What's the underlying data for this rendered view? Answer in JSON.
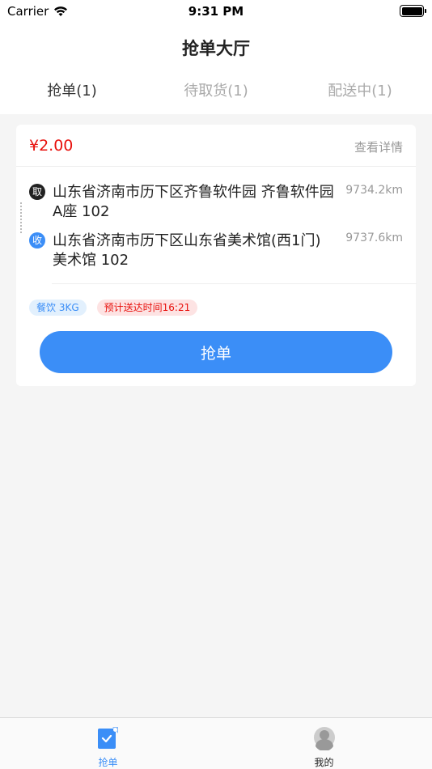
{
  "status_bar": {
    "carrier": "Carrier",
    "time": "9:31 PM"
  },
  "nav": {
    "title": "抢单大厅"
  },
  "tabs": [
    {
      "label": "抢单(1)",
      "active": true
    },
    {
      "label": "待取货(1)",
      "active": false
    },
    {
      "label": "配送中(1)",
      "active": false
    }
  ],
  "order": {
    "price": "¥2.00",
    "detail_label": "查看详情",
    "pickup": {
      "badge": "取",
      "address": "山东省济南市历下区齐鲁软件园 齐鲁软件园A座 102",
      "distance": "9734.2km"
    },
    "dropoff": {
      "badge": "收",
      "address": "山东省济南市历下区山东省美术馆(西1门) 美术馆 102",
      "distance": "9737.6km"
    },
    "tags": {
      "category": "餐饮 3KG",
      "eta": "预计送达时间16:21"
    },
    "grab_label": "抢单"
  },
  "tabbar": [
    {
      "label": "抢单",
      "icon": "grab-order-icon",
      "active": true
    },
    {
      "label": "我的",
      "icon": "user-avatar-icon",
      "active": false
    }
  ],
  "colors": {
    "accent": "#3b8ef7",
    "price": "#e8100c",
    "background": "#f5f5f5"
  }
}
